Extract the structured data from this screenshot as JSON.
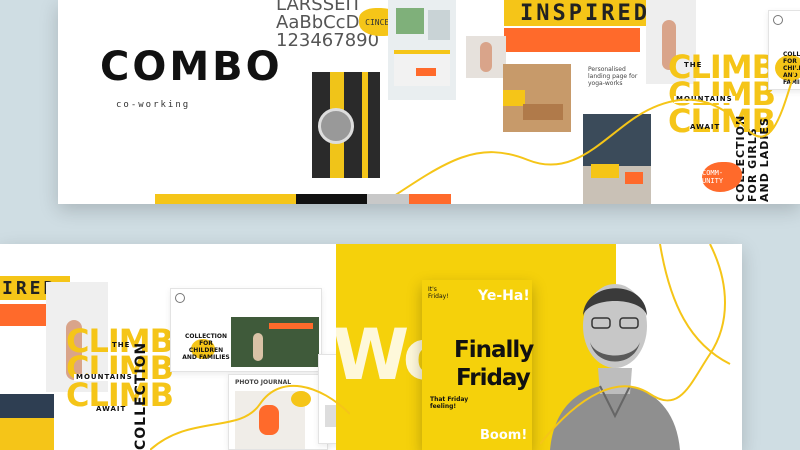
{
  "top": {
    "brand": "COMBO",
    "subtitle": "co-working",
    "type_sample": [
      "LARSSEIT",
      "AaBbCcD",
      "123467890"
    ],
    "font_badge": "CINCERE",
    "inspired": "INSPIRED",
    "landing_note": "Personalised landing page for yoga-works",
    "climb_word": "CLIMB",
    "climb_tagline": [
      "THE",
      "MOUNTAINS",
      "AWAIT"
    ],
    "collection_vertical": "COLLECTION FOR GIRLS AND LADIES",
    "collection_small": "COLLECTION FOR CHILDREN AND FAMILIES",
    "community_badge": "COMM-UNITY",
    "palette": [
      "#f5c518",
      "#f5c518",
      "#111111",
      "#c8c8c8",
      "#ff6a2b"
    ]
  },
  "bottom": {
    "inspired_partial": "IRED",
    "climb_word": "CLIMB",
    "climb_tagline": [
      "THE",
      "MOUNTAINS",
      "AWAIT"
    ],
    "collection_vertical": "COLLECTION",
    "site_heading": "COLLECTION FOR CHILDREN AND FAMILIES",
    "photo_journal": "PHOTO JOURNAL",
    "woo_bg": "Woo",
    "poster": {
      "top_left": "It's Friday!",
      "yeha": "Ye-Ha!",
      "headline_1": "Finally",
      "headline_2": "Friday",
      "subline": "That Friday feeling!",
      "boom": "Boom!"
    }
  },
  "colors": {
    "yellow": "#f5c518",
    "orange": "#ff6a2b",
    "dark": "#111111"
  }
}
